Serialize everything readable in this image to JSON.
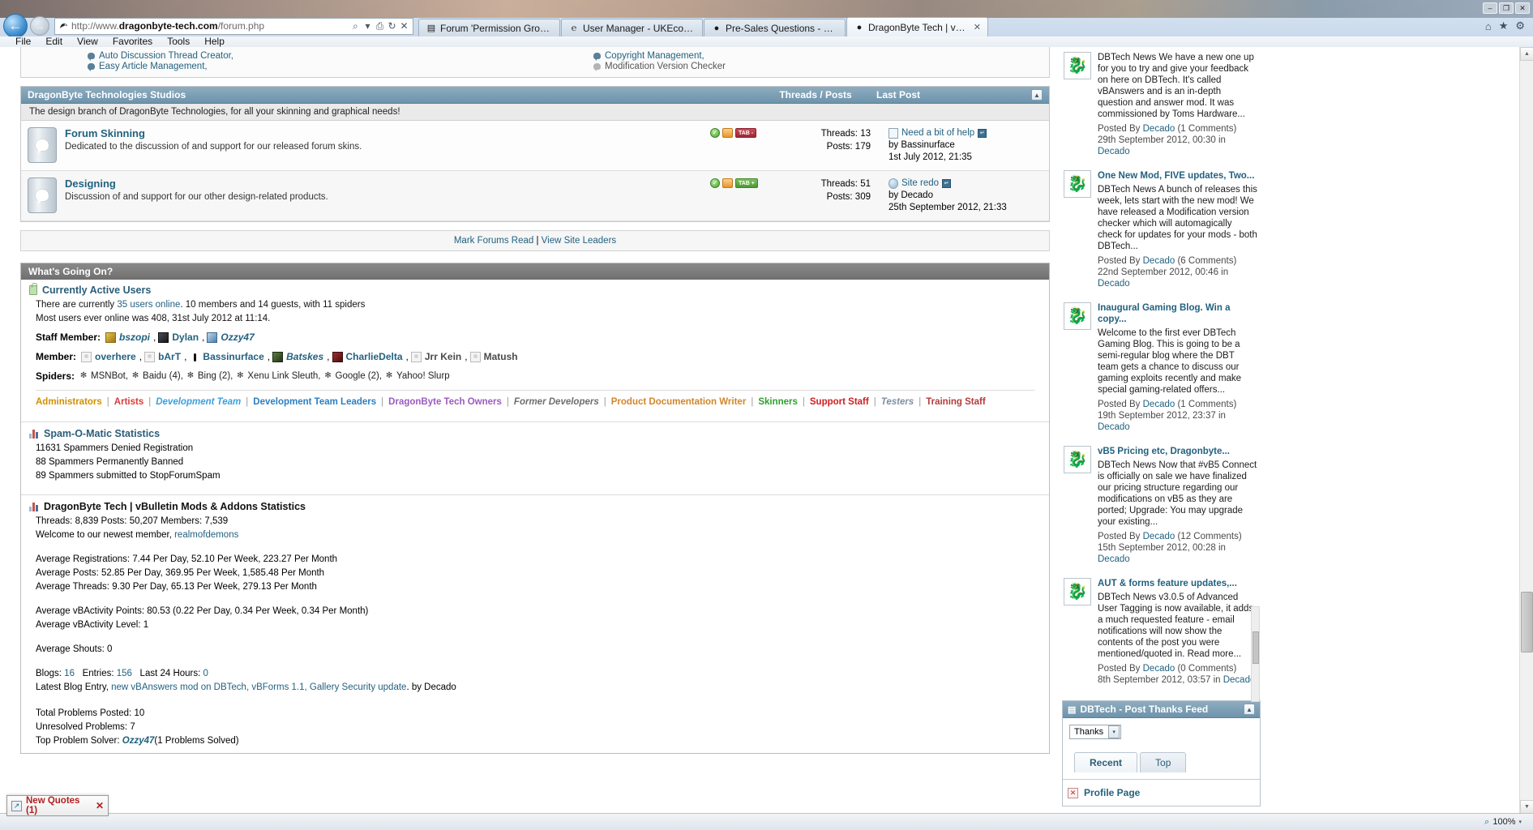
{
  "browser": {
    "url_prefix": "http://www.",
    "url_domain": "dragonbyte-tech.com",
    "url_suffix": "/forum.php",
    "back_icon": "←",
    "forward_icon": "→",
    "search_icon": "⌕",
    "dropdown_icon": "▾",
    "compat_icon": "⎙",
    "refresh_icon": "↻",
    "stop_icon": "✕",
    "home_icon": "⌂",
    "star_icon": "★",
    "gear_icon": "⚙",
    "minimize_label": "–",
    "maximize_label": "❐",
    "close_label": "✕",
    "tabs": [
      {
        "label": "Forum 'Permission Groups'",
        "favicon": "▤",
        "active": false
      },
      {
        "label": "User Manager - UKEconomy.tv...",
        "favicon": "℮",
        "active": false
      },
      {
        "label": "Pre-Sales Questions - Post Ne...",
        "favicon": "●",
        "active": false
      },
      {
        "label": "DragonByte Tech | vBulletin...",
        "favicon": "●",
        "active": true,
        "close": "✕"
      }
    ],
    "menus": [
      "File",
      "Edit",
      "View",
      "Favorites",
      "Tools",
      "Help"
    ]
  },
  "top_mods": {
    "left": [
      "Auto Discussion Thread Creator,",
      "Easy Article Management,"
    ],
    "right": [
      "Copyright Management,",
      "Modification Version Checker"
    ]
  },
  "category": {
    "title": "DragonByte Technologies Studios",
    "col_threads": "Threads / Posts",
    "col_lastpost": "Last Post",
    "collapse_icon": "▲",
    "description": "The design branch of DragonByte Technologies, for all your skinning and graphical needs!",
    "forums": [
      {
        "title": "Forum Skinning",
        "description": "Dedicated to the discussion of and support for our released forum skins.",
        "threads": "Threads: 13",
        "posts": "Posts: 179",
        "flag_check": "✓",
        "flag_rss": "RSS",
        "flag_tab": "TAB -",
        "flag_tab_color": "red",
        "last_post_title": "Need a bit of help",
        "last_post_badge": "↵",
        "last_post_author": "by Bassinurface",
        "last_post_date": "1st July 2012, 21:35",
        "last_post_icon": "doc"
      },
      {
        "title": "Designing",
        "description": "Discussion of and support for our other design-related products.",
        "threads": "Threads: 51",
        "posts": "Posts: 309",
        "flag_check": "✓",
        "flag_rss": "RSS",
        "flag_tab": "TAB +",
        "flag_tab_color": "green",
        "last_post_title": "Site redo",
        "last_post_badge": "↵",
        "last_post_author": "by Decado",
        "last_post_date": "25th September 2012, 21:33",
        "last_post_icon": "circle"
      }
    ]
  },
  "markread": {
    "mark_forums_read": "Mark Forums Read",
    "separator": "|",
    "view_site_leaders": "View Site Leaders"
  },
  "wgo": {
    "header": "What's Going On?",
    "active_users": {
      "title": "Currently Active Users",
      "line1_pre": "There are currently ",
      "line1_link": "35 users online",
      "line1_post": ". 10 members and 14 guests, with 11 spiders",
      "line2": "Most users ever online was 408, 31st July 2012 at 11:14.",
      "staff_label": "Staff Member:",
      "staff": [
        {
          "name": "bszopi",
          "avatar": "gold",
          "italic": true
        },
        {
          "name": "Dylan",
          "avatar": "dark",
          "italic": false
        },
        {
          "name": "Ozzy47",
          "avatar": "blue",
          "italic": true
        }
      ],
      "member_label": "Member:",
      "members": [
        {
          "name": "overhere",
          "avatar": "blank",
          "italic": false,
          "plain": false
        },
        {
          "name": "bArT",
          "avatar": "blank",
          "italic": false,
          "plain": false
        },
        {
          "name": "Bassinurface",
          "avatar": "black",
          "italic": false,
          "plain": false
        },
        {
          "name": "Batskes",
          "avatar": "green",
          "italic": true,
          "plain": false
        },
        {
          "name": "CharlieDelta",
          "avatar": "red",
          "italic": false,
          "plain": false
        },
        {
          "name": "Jrr Kein",
          "avatar": "blank",
          "italic": false,
          "plain": true
        },
        {
          "name": "Matush",
          "avatar": "blank",
          "italic": false,
          "plain": true
        }
      ],
      "spiders_label": "Spiders:",
      "spider_icon": "✻",
      "spiders": [
        "MSNBot,",
        "Baidu (4),",
        "Bing (2),",
        "Xenu Link Sleuth,",
        "Google (2),",
        "Yahoo! Slurp"
      ]
    },
    "legend": [
      {
        "label": "Administrators",
        "color": "#d18f00",
        "italic": false
      },
      {
        "label": "Artists",
        "color": "#d93b3b",
        "italic": false
      },
      {
        "label": "Development Team",
        "color": "#3aa0e0",
        "italic": true
      },
      {
        "label": "Development Team Leaders",
        "color": "#2a7fc4",
        "italic": false
      },
      {
        "label": "DragonByte Tech Owners",
        "color": "#9b5bbf",
        "italic": false
      },
      {
        "label": "Former Developers",
        "color": "#6f6f6f",
        "italic": true
      },
      {
        "label": "Product Documentation Writer",
        "color": "#d1862b",
        "italic": false
      },
      {
        "label": "Skinners",
        "color": "#2ea02e",
        "italic": false
      },
      {
        "label": "Support Staff",
        "color": "#cf2020",
        "italic": false
      },
      {
        "label": "Testers",
        "color": "#7f8fa0",
        "italic": true
      },
      {
        "label": "Training Staff",
        "color": "#b53a3a",
        "italic": false
      }
    ],
    "spam": {
      "title": "Spam-O-Matic Statistics",
      "lines": [
        "11631 Spammers Denied Registration",
        "88 Spammers Permanently Banned",
        "89 Spammers submitted to StopForumSpam"
      ]
    },
    "forum_stats": {
      "title": "DragonByte Tech | vBulletin Mods & Addons Statistics",
      "counts": "Threads: 8,839  Posts: 50,207  Members: 7,539",
      "welcome_pre": "Welcome to our newest member, ",
      "welcome_link": "realmofdemons",
      "avg_registrations": "Average Registrations: 7.44 Per Day, 52.10 Per Week, 223.27 Per Month",
      "avg_posts": "Average Posts: 52.85 Per Day, 369.95 Per Week, 1,585.48 Per Month",
      "avg_threads": "Average Threads: 9.30 Per Day, 65.13 Per Week, 279.13 Per Month",
      "avg_vbactivity_points": "Average vBActivity Points: 80.53 (0.22 Per Day, 0.34 Per Week, 0.34 Per Month)",
      "avg_vbactivity_level": "Average vBActivity Level: 1",
      "avg_shouts": "Average Shouts: 0",
      "blogs_label": "Blogs:",
      "blogs_value": "16",
      "entries_label": "Entries:",
      "entries_value": "156",
      "last24_label": "Last 24 Hours:",
      "last24_value": "0",
      "latest_blog_label": "Latest Blog Entry,",
      "latest_blog_link": "new vBAnswers mod on DBTech, vBForms 1.1, Gallery Security update",
      "latest_blog_by": ". by Decado",
      "total_problems": "Total Problems Posted: 10",
      "unresolved_problems": "Unresolved Problems: 7",
      "top_solver_pre": "Top Problem Solver: ",
      "top_solver_name": "Ozzy47",
      "top_solver_post": "(1 Problems Solved)"
    }
  },
  "sidebar": {
    "news": [
      {
        "title": "",
        "text": "DBTech News We have a new one up for you to try and give your feedback on here on DBTech. It's called vBAnswers and is an in-depth question and answer mod. It was commissioned by Toms Hardware...",
        "meta_pre": "Posted By ",
        "meta_author": "Decado",
        "meta_comments": "(1 Comments)",
        "meta_date": "29th September 2012, 00:30 in ",
        "meta_in": "Decado"
      },
      {
        "title": "One New Mod, FIVE updates, Two...",
        "text": "DBTech News A bunch of releases this week, lets start with the new mod! We have released a Modification version checker which will automagically check for updates for your mods - both DBTech...",
        "meta_pre": "Posted By ",
        "meta_author": "Decado",
        "meta_comments": "(6 Comments)",
        "meta_date": "22nd September 2012, 00:46 in ",
        "meta_in": "Decado"
      },
      {
        "title": "Inaugural Gaming Blog. Win a copy...",
        "text": "Welcome to the first ever DBTech Gaming Blog. This is going to be a semi-regular blog where the DBT team gets a chance to discuss our gaming exploits recently and make special gaming-related offers...",
        "meta_pre": "Posted By ",
        "meta_author": "Decado",
        "meta_comments": "(1 Comments)",
        "meta_date": "19th September 2012, 23:37 in ",
        "meta_in": "Decado"
      },
      {
        "title": "vB5 Pricing etc, Dragonbyte...",
        "text": "DBTech News Now that #vB5 Connect is officially on sale we have finalized our pricing structure regarding our modifications on vB5 as they are ported; Upgrade: You may upgrade your existing...",
        "meta_pre": "Posted By ",
        "meta_author": "Decado",
        "meta_comments": "(12 Comments)",
        "meta_date": "15th September 2012, 00:28 in ",
        "meta_in": "Decado"
      },
      {
        "title": "AUT & forms feature updates,...",
        "text": "DBTech News v3.0.5 of Advanced User Tagging is now available, it adds a much requested feature - email notifications will now show the contents of the post you were mentioned/quoted in. Read more...",
        "meta_pre": "Posted By ",
        "meta_author": "Decado",
        "meta_comments": "(0 Comments)",
        "meta_date": "8th September 2012, 03:57 in ",
        "meta_in": "Decado"
      }
    ],
    "thanks_panel": {
      "header": "DBTech - Post Thanks Feed",
      "header_icon": "▤",
      "collapse_icon": "▲",
      "select_value": "Thanks",
      "select_arrow": "▾",
      "tabs": [
        {
          "label": "Recent",
          "active": true
        },
        {
          "label": "Top",
          "active": false
        }
      ],
      "row_close": "✕",
      "row_link": "Profile Page"
    }
  },
  "statusbar": {
    "zoom_icon": "⌕",
    "zoom_level": "100%",
    "zoom_arrow": "▾"
  },
  "new_quotes": {
    "icon": "↗",
    "label": "New Quotes (1)",
    "close": "✕"
  },
  "scroll": {
    "up_arrow": "▲",
    "down_arrow": "▼"
  }
}
